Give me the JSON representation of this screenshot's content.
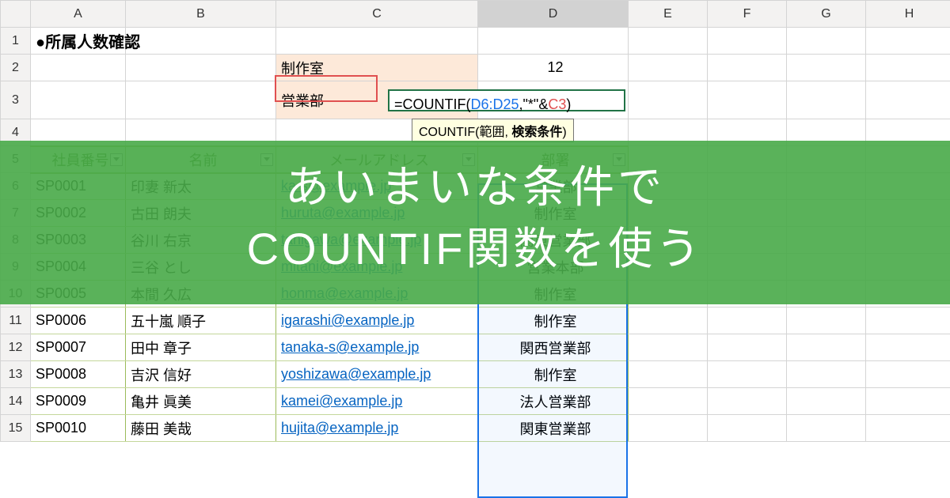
{
  "columns": [
    "A",
    "B",
    "C",
    "D",
    "E",
    "F",
    "G",
    "H"
  ],
  "rows": [
    "1",
    "2",
    "3",
    "4",
    "5",
    "6",
    "7",
    "8",
    "9",
    "10",
    "11",
    "12",
    "13",
    "14",
    "15"
  ],
  "selected_col": "D",
  "r1": {
    "A": "●所属人数確認"
  },
  "r2": {
    "C": "制作室",
    "D": "12"
  },
  "r3": {
    "C": "営業部"
  },
  "formula": {
    "prefix": "=COUNTIF(",
    "range": "D6:D25",
    "mid": ",\"*\"&",
    "ref": "C3",
    "suffix": ")"
  },
  "tooltip": {
    "fn": "COUNTIF(",
    "a1": "範囲",
    "sep": ", ",
    "a2": "検索条件",
    "end": ")"
  },
  "header": {
    "id": "社員番号",
    "name": "名前",
    "mail": "メールアドレス",
    "dep": "部署"
  },
  "data": [
    {
      "id": "SP0001",
      "name": "印妻 新太",
      "mail": "ka-s@example.jp",
      "dep": "営業部"
    },
    {
      "id": "SP0002",
      "name": "古田 朗夫",
      "mail": "huruta@example.jp",
      "dep": "制作室"
    },
    {
      "id": "SP0003",
      "name": "谷川 右京",
      "mail": "tanigawa@example.jp",
      "dep": "関東営業部"
    },
    {
      "id": "SP0004",
      "name": "三谷 とし",
      "mail": "mitani@example.jp",
      "dep": "営業本部"
    },
    {
      "id": "SP0005",
      "name": "本間 久広",
      "mail": "honma@example.jp",
      "dep": "制作室"
    },
    {
      "id": "SP0006",
      "name": "五十嵐 順子",
      "mail": "igarashi@example.jp",
      "dep": "制作室"
    },
    {
      "id": "SP0007",
      "name": "田中 章子",
      "mail": "tanaka-s@example.jp",
      "dep": "関西営業部"
    },
    {
      "id": "SP0008",
      "name": "吉沢 信好",
      "mail": "yoshizawa@example.jp",
      "dep": "制作室"
    },
    {
      "id": "SP0009",
      "name": "亀井 眞美",
      "mail": "kamei@example.jp",
      "dep": "法人営業部"
    },
    {
      "id": "SP0010",
      "name": "藤田 美哉",
      "mail": "hujita@example.jp",
      "dep": "関東営業部"
    }
  ],
  "banner": {
    "l1": "あいまいな条件で",
    "l2": "COUNTIF関数を使う"
  }
}
